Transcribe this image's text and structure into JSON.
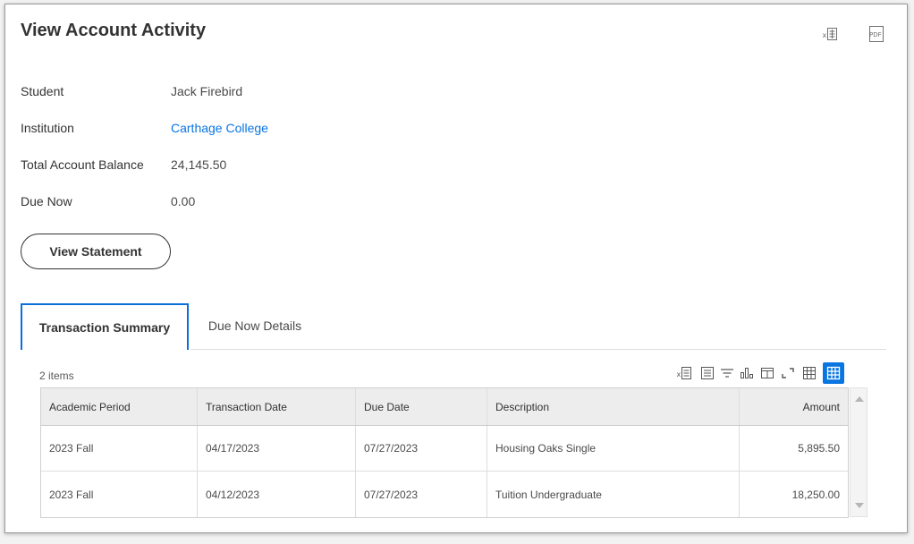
{
  "page": {
    "title": "View Account Activity",
    "export_excel_icon": "excel-export-icon",
    "export_pdf_icon": "pdf-export-icon",
    "pdf_label": "PDF"
  },
  "fields": [
    {
      "label": "Student",
      "value": "Jack Firebird"
    },
    {
      "label": "Institution",
      "value": "Carthage College"
    },
    {
      "label": "Total Account Balance",
      "value": "24,145.50"
    },
    {
      "label": "Due Now",
      "value": "0.00"
    }
  ],
  "buttons": {
    "view_statement": "View Statement"
  },
  "tabs": [
    {
      "label": "Transaction Summary",
      "active": true
    },
    {
      "label": "Due Now Details",
      "active": false
    }
  ],
  "table": {
    "count_label": "2 items",
    "toolbar_icons": [
      "excel-export-icon",
      "view-details-icon",
      "filter-icon",
      "chart-icon",
      "columns-icon",
      "fullscreen-icon",
      "table-view-icon",
      "grid-view-icon"
    ],
    "columns": [
      "Academic Period",
      "Transaction Date",
      "Due Date",
      "Description",
      "Amount"
    ],
    "rows": [
      [
        "2023 Fall",
        "04/17/2023",
        "07/27/2023",
        "Housing Oaks Single",
        "5,895.50"
      ],
      [
        "2023 Fall",
        "04/12/2023",
        "07/27/2023",
        "Tuition Undergraduate",
        "18,250.00"
      ]
    ]
  },
  "colors": {
    "accent": "#0875e1",
    "tab_border": "#0b6fd8",
    "header_bg": "#ededed"
  }
}
